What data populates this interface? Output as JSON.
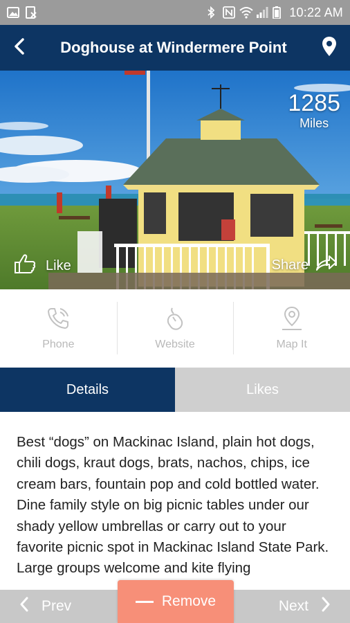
{
  "status_bar": {
    "time": "10:22 AM",
    "icons": [
      "image-icon",
      "file-icon",
      "bluetooth-icon",
      "nfc-icon",
      "wifi-icon",
      "signal-icon",
      "battery-icon"
    ]
  },
  "app_bar": {
    "title": "Doghouse at Windermere Point",
    "back_icon": "chevron-left-icon",
    "location_icon": "map-pin-icon"
  },
  "hero": {
    "distance_value": "1285",
    "distance_unit": "Miles",
    "like_label": "Like",
    "share_label": "Share"
  },
  "actions": [
    {
      "label": "Phone",
      "icon": "phone-icon"
    },
    {
      "label": "Website",
      "icon": "mouse-icon"
    },
    {
      "label": "Map It",
      "icon": "map-pin-icon"
    }
  ],
  "tabs": {
    "details": "Details",
    "likes": "Likes"
  },
  "description": "Best “dogs” on Mackinac Island, plain hot dogs, chili dogs, kraut dogs, brats, nachos, chips, ice cream bars, fountain pop and cold bottled water. Dine family style on big picnic tables under our shady yellow umbrellas or carry out to your favorite picnic spot in Mackinac Island State Park. Large groups welcome and kite flying",
  "bottom_bar": {
    "prev_label": "Prev",
    "next_label": "Next",
    "remove_label": "Remove"
  },
  "colors": {
    "primary": "#0d3563",
    "remove": "#f78f78",
    "inactive_tab": "#cfcfcf",
    "bottom_bar": "#c8c8c8"
  }
}
